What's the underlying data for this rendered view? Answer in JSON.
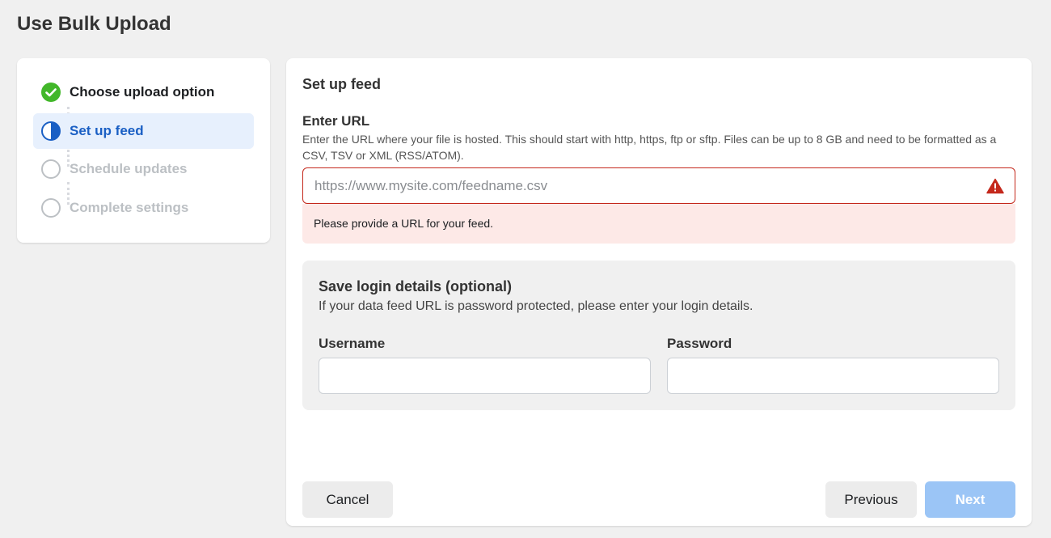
{
  "page": {
    "title": "Use Bulk Upload"
  },
  "stepper": {
    "steps": [
      {
        "label": "Choose upload option",
        "state": "done"
      },
      {
        "label": "Set up feed",
        "state": "current"
      },
      {
        "label": "Schedule updates",
        "state": "pending"
      },
      {
        "label": "Complete settings",
        "state": "pending"
      }
    ]
  },
  "feed": {
    "section_title": "Set up feed",
    "url_label": "Enter URL",
    "url_help": "Enter the URL where your file is hosted. This should start with http, https, ftp or sftp. Files can be up to 8 GB and need to be formatted as a CSV, TSV or XML (RSS/ATOM).",
    "url_value": "",
    "url_placeholder": "https://www.mysite.com/feedname.csv",
    "error_message": "Please provide a URL for your feed."
  },
  "login": {
    "title": "Save login details (optional)",
    "description": "If your data feed URL is password protected, please enter your login details.",
    "username_label": "Username",
    "username_value": "",
    "password_label": "Password",
    "password_value": ""
  },
  "footer": {
    "cancel_label": "Cancel",
    "previous_label": "Previous",
    "next_label": "Next"
  },
  "colors": {
    "success": "#42b72a",
    "primary": "#1a5fc4",
    "error": "#c4281c",
    "pending": "#bcc0c4",
    "next_disabled": "#9bc5f6"
  },
  "icons": {
    "step_done": "check-circle-icon",
    "step_current": "half-circle-icon",
    "step_pending": "empty-circle-icon",
    "url_error": "warning-triangle-icon"
  }
}
